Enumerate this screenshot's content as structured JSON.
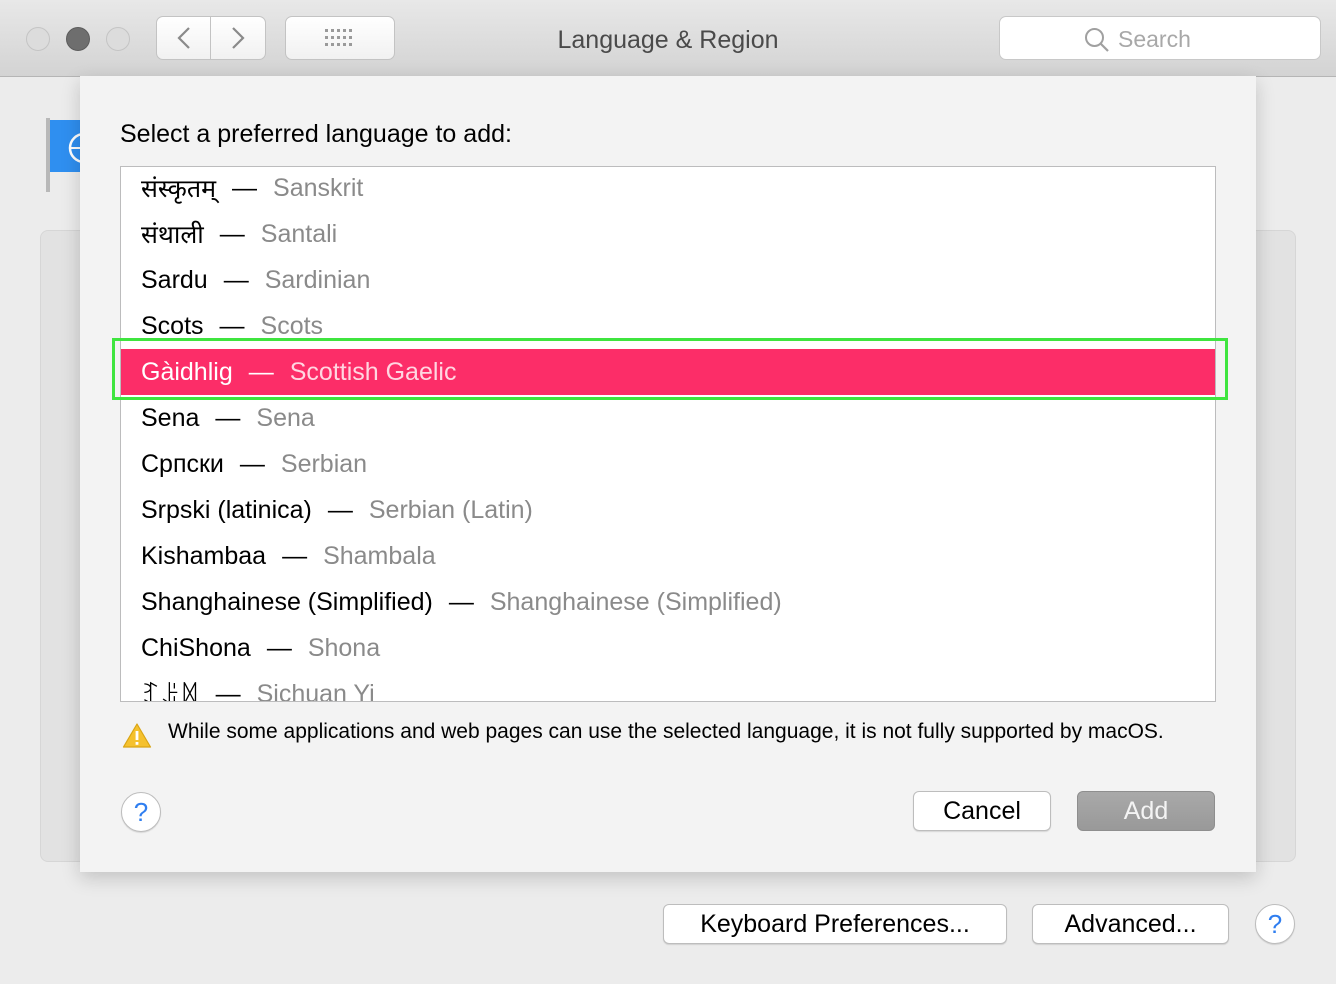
{
  "window": {
    "title": "Language & Region",
    "search_placeholder": "Search"
  },
  "sheet": {
    "heading": "Select a preferred language to add:",
    "languages": [
      {
        "native": "संस्कृतम्",
        "english": "Sanskrit"
      },
      {
        "native": "संथाली",
        "english": "Santali"
      },
      {
        "native": "Sardu",
        "english": "Sardinian"
      },
      {
        "native": "Scots",
        "english": "Scots"
      },
      {
        "native": "Gàidhlig",
        "english": "Scottish Gaelic"
      },
      {
        "native": "Sena",
        "english": "Sena"
      },
      {
        "native": "Српски",
        "english": "Serbian"
      },
      {
        "native": "Srpski (latinica)",
        "english": "Serbian (Latin)"
      },
      {
        "native": "Kishambaa",
        "english": "Shambala"
      },
      {
        "native": "Shanghainese (Simplified)",
        "english": "Shanghainese (Simplified)"
      },
      {
        "native": "ChiShona",
        "english": "Shona"
      },
      {
        "native": "ꆈꌠꉙ",
        "english": "Sichuan Yi"
      }
    ],
    "separator": "—",
    "selected_language": "Gàidhlig",
    "warning": "While some applications and web pages can use the selected language, it is not fully supported by macOS.",
    "help_label": "?",
    "cancel_label": "Cancel",
    "add_label": "Add"
  },
  "pane": {
    "keyboard_prefs_label": "Keyboard Preferences...",
    "advanced_label": "Advanced...",
    "help_label": "?"
  },
  "colors": {
    "selection": "#fc2d68",
    "highlight_outline": "#3fe53f",
    "help_accent": "#2f7ef0"
  },
  "icons": [
    "back-arrow-icon",
    "forward-arrow-icon",
    "grid-icon",
    "search-icon",
    "flag-icon",
    "warning-icon"
  ]
}
